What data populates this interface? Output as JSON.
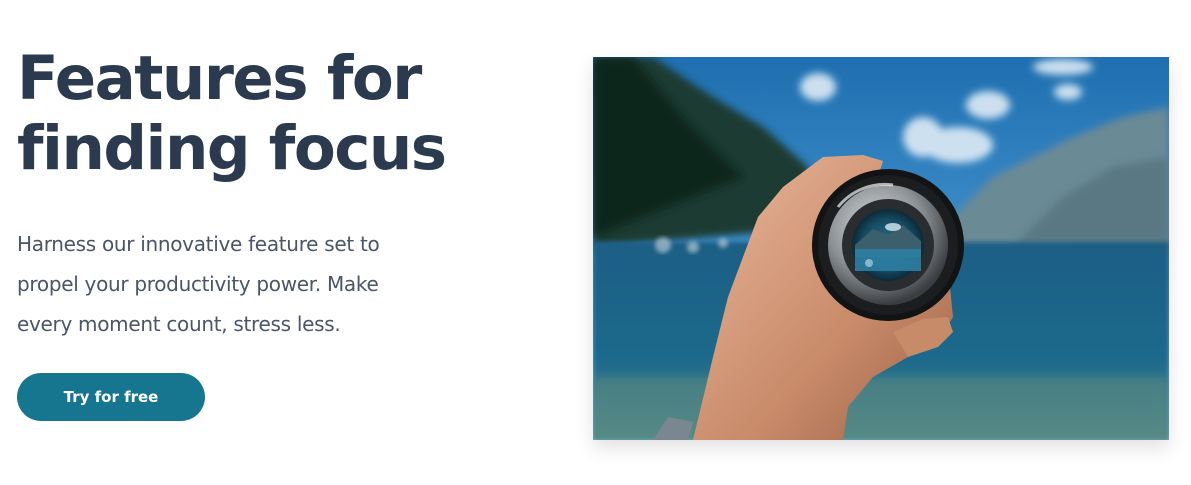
{
  "hero": {
    "headline_line1": "Features for",
    "headline_line2": "finding focus",
    "description": "Harness our innovative feature set to propel your productivity power. Make every moment count, stress less.",
    "cta_label": "Try for free"
  },
  "image": {
    "subject": "hand holding camera lens in front of mountain lake"
  },
  "colors": {
    "headline": "#2b3a4e",
    "body_text": "#4a5567",
    "cta_background": "#16768f",
    "cta_text": "#ffffff"
  }
}
